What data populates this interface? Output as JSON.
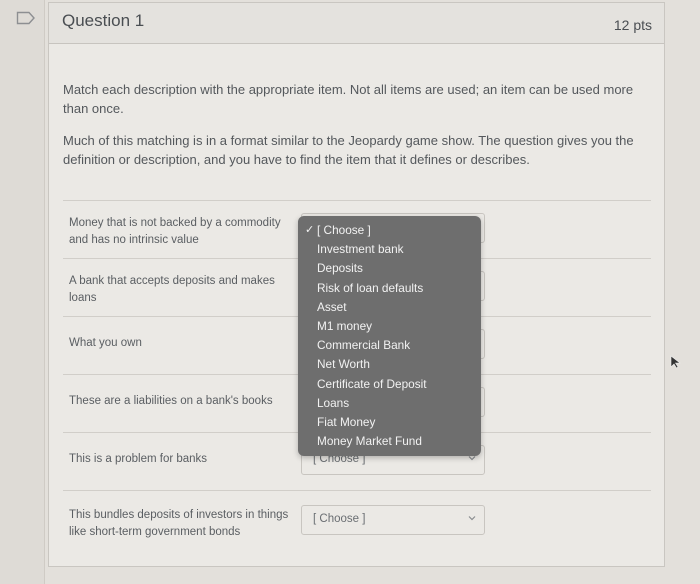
{
  "question": {
    "title": "Question 1",
    "points": "12 pts",
    "instructions": [
      "Match each description with the appropriate item.   Not all items are used; an item can be used more than once.",
      "Much of this matching is in a  format similar to the Jeopardy game show.  The question gives you the definition or description, and you have to find the item that it defines or describes."
    ]
  },
  "matches": [
    {
      "description": "Money that is not backed by a commodity and has no intrinsic value",
      "selected": "[ Choose ]"
    },
    {
      "description": "A bank that accepts deposits and makes loans",
      "selected": "[ Choose ]"
    },
    {
      "description": "What you own",
      "selected": "[ Choose ]"
    },
    {
      "description": "These are a liabilities on a bank's books",
      "selected": "[ Choose ]"
    },
    {
      "description": "This is a problem for banks",
      "selected": "[ Choose ]"
    },
    {
      "description": "This bundles deposits of investors in things like short-term government bonds",
      "selected": "[ Choose ]"
    }
  ],
  "dropdown": {
    "open_for_row": 0,
    "options": [
      {
        "label": "[ Choose ]",
        "checked": true
      },
      {
        "label": "Investment bank",
        "checked": false
      },
      {
        "label": "Deposits",
        "checked": false
      },
      {
        "label": "Risk of loan defaults",
        "checked": false
      },
      {
        "label": "Asset",
        "checked": false
      },
      {
        "label": "M1 money",
        "checked": false
      },
      {
        "label": "Commercial Bank",
        "checked": false
      },
      {
        "label": "Net Worth",
        "checked": false
      },
      {
        "label": "Certificate of Deposit",
        "checked": false
      },
      {
        "label": "Loans",
        "checked": false
      },
      {
        "label": "Fiat Money",
        "checked": false
      },
      {
        "label": "Money Market Fund",
        "checked": false
      }
    ],
    "check_glyph": "✓"
  },
  "icons": {
    "flag": "flag-question-icon",
    "chevron": "chevron-down-icon",
    "cursor": "mouse-pointer-icon"
  },
  "colors": {
    "menu_bg": "#6e6e6e",
    "page_bg": "#e3e0db",
    "card_bg": "#ebe9e5"
  }
}
